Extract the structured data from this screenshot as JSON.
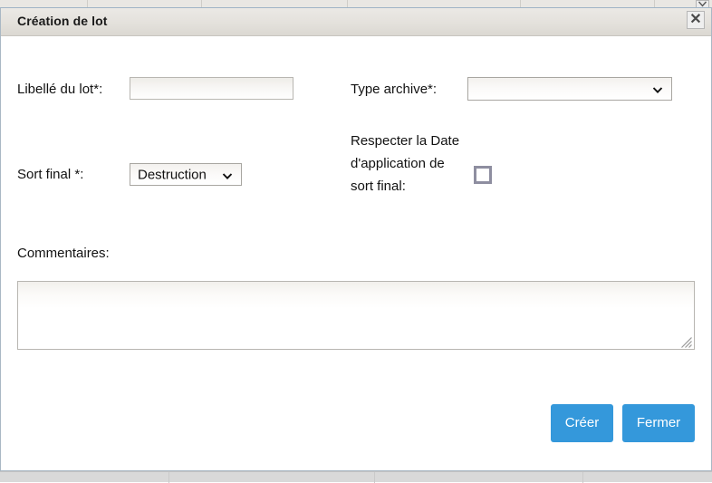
{
  "backdrop": {
    "scroll_arrow_icon": "chevron-down-icon"
  },
  "dialog": {
    "title": "Création de lot",
    "close_label": "✕",
    "close_icon": "close-icon"
  },
  "form": {
    "libelle": {
      "label": "Libellé du lot*:",
      "value": "",
      "placeholder": ""
    },
    "type_archive": {
      "label": "Type archive*:",
      "value": "",
      "arrow_icon": "chevron-down-icon",
      "options": [
        ""
      ]
    },
    "sort_final": {
      "label": "Sort final *:",
      "value": "Destruction",
      "arrow_icon": "chevron-down-icon",
      "options": [
        "Destruction"
      ]
    },
    "respecter_date": {
      "label": "Respecter la Date d'application de sort final:",
      "checked": false
    },
    "commentaires": {
      "label": "Commentaires:",
      "value": "",
      "placeholder": "",
      "resize_icon": "resize-grip-icon"
    }
  },
  "actions": {
    "create_label": "Créer",
    "close_label": "Fermer"
  },
  "colors": {
    "button_blue": "#3498db",
    "titlebar": "#e4e1dc",
    "dialog_border": "#a9b8c4",
    "checkbox_border": "#8e8ea0"
  }
}
